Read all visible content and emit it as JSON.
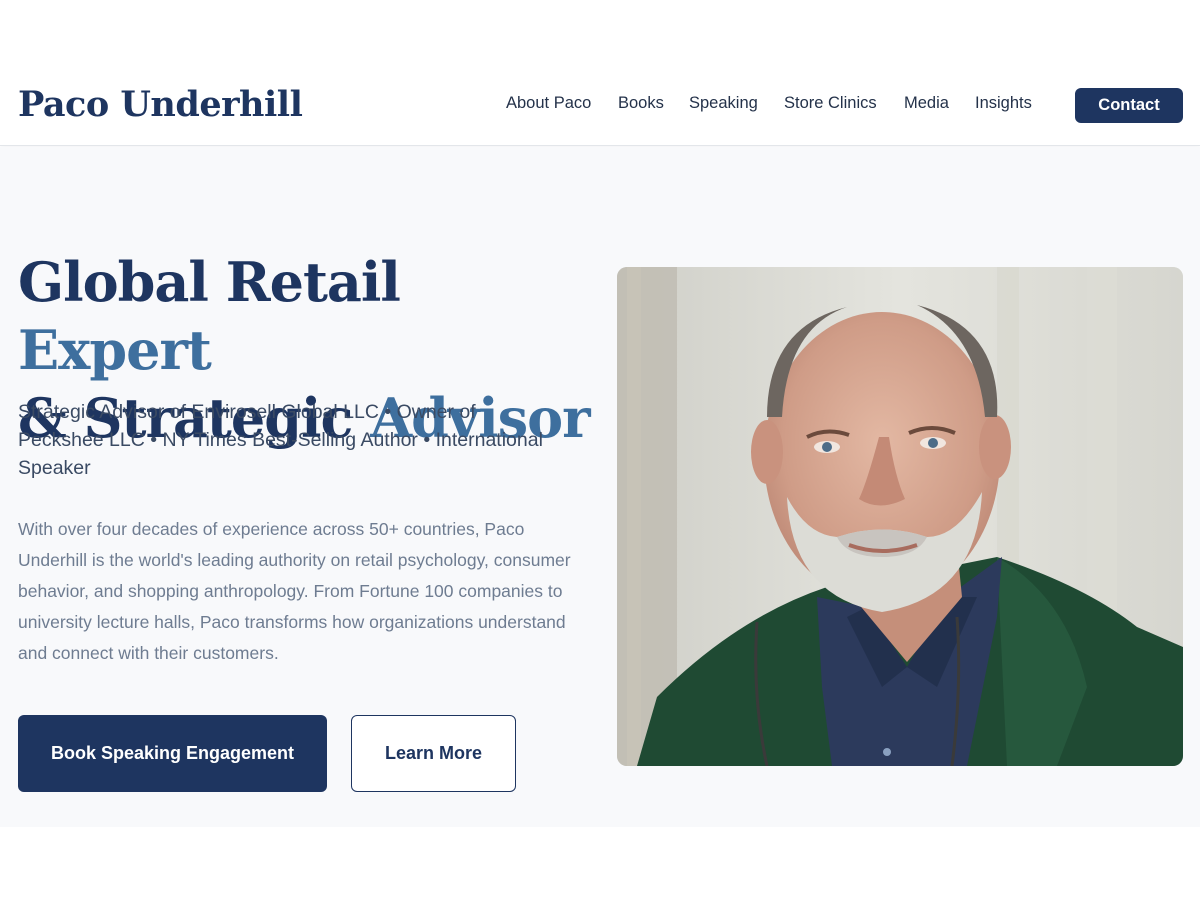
{
  "header": {
    "logo": "Paco Underhill",
    "nav": [
      {
        "label": "About Paco"
      },
      {
        "label": "Books"
      },
      {
        "label": "Speaking"
      },
      {
        "label": "Store Clinics"
      },
      {
        "label": "Media"
      },
      {
        "label": "Insights"
      }
    ],
    "contact_label": "Contact"
  },
  "hero": {
    "headline": {
      "line1_dark": "Global Retail",
      "line1_accent": "Expert",
      "line2_dark": "& Strategic",
      "line2_accent": "Advisor"
    },
    "subheading": "Strategic Advisor of Envirosell Global LLC • Owner of Peckshee LLC • NY Times Best-Selling Author • International Speaker",
    "body": "With over four decades of experience across 50+ countries, Paco Underhill is the world's leading authority on retail psychology, consumer behavior, and shopping anthropology. From Fortune 100 companies to university lecture halls, Paco transforms how organizations understand and connect with their customers.",
    "primary_button": "Book Speaking Engagement",
    "secondary_button": "Learn More"
  },
  "colors": {
    "brand_navy": "#1e3560",
    "accent_blue": "#3e6f9e",
    "body_gray": "#6e7c91",
    "hero_bg": "#f8f9fb"
  }
}
